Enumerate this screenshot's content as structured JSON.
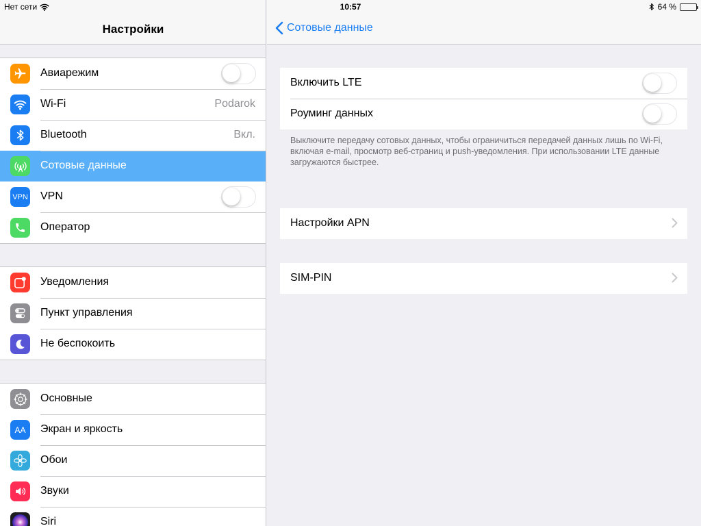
{
  "status_bar": {
    "carrier": "Нет сети",
    "time": "10:57",
    "battery_percent": "64 %",
    "battery_level": 0.64
  },
  "sidebar": {
    "title": "Настройки",
    "groups": [
      [
        {
          "label": "Авиарежим",
          "icon": "airplane-icon",
          "color": "#ff9500",
          "accessory": "toggle"
        },
        {
          "label": "Wi-Fi",
          "icon": "wifi-icon",
          "color": "#1a7ef2",
          "value": "Podarok"
        },
        {
          "label": "Bluetooth",
          "icon": "bluetooth-icon",
          "color": "#1a7ef2",
          "value": "Вкл."
        },
        {
          "label": "Сотовые данные",
          "icon": "cellular-antenna-icon",
          "color": "#4cd964",
          "selected": true
        },
        {
          "label": "VPN",
          "icon": "vpn-icon",
          "color": "#1a7ef2",
          "icon_text": "VPN",
          "accessory": "toggle"
        },
        {
          "label": "Оператор",
          "icon": "phone-icon",
          "color": "#4cd964"
        }
      ],
      [
        {
          "label": "Уведомления",
          "icon": "notifications-icon",
          "color": "#ff3b30"
        },
        {
          "label": "Пункт управления",
          "icon": "control-center-icon",
          "color": "#8e8e93"
        },
        {
          "label": "Не беспокоить",
          "icon": "moon-icon",
          "color": "#5856d6"
        }
      ],
      [
        {
          "label": "Основные",
          "icon": "gear-icon",
          "color": "#8e8e93"
        },
        {
          "label": "Экран и яркость",
          "icon": "display-brightness-icon",
          "color": "#1a7ef2",
          "icon_text": "AA"
        },
        {
          "label": "Обои",
          "icon": "wallpaper-flower-icon",
          "color": "#34aadc"
        },
        {
          "label": "Звуки",
          "icon": "speaker-icon",
          "color": "#ff2d55"
        },
        {
          "label": "Siri",
          "icon": "siri-icon",
          "color": "#1c1c1e"
        }
      ]
    ]
  },
  "detail": {
    "back_label": "Сотовые данные",
    "lte_group": {
      "enable_lte_label": "Включить LTE",
      "roaming_label": "Роуминг данных"
    },
    "footnote": "Выключите передачу сотовых данных, чтобы ограничиться передачей данных лишь по Wi-Fi, включая e-mail, просмотр веб-страниц и push-уведомления. При использовании LTE данные загружаются быстрее.",
    "apn_label": "Настройки APN",
    "simpin_label": "SIM-PIN"
  },
  "colors": {
    "accent": "#1a7ef2",
    "selected_row": "#5ab0f8"
  }
}
